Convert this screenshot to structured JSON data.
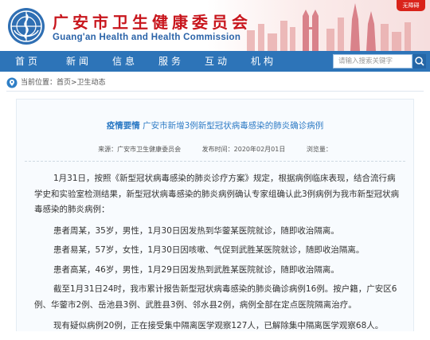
{
  "header": {
    "title": "广安市卫生健康委员会",
    "subtitle": "Guang'an Health and Health Commission",
    "corner_flag": "无障碍"
  },
  "nav": {
    "items": [
      "首页",
      "新闻",
      "信息",
      "服务",
      "互动",
      "机构"
    ],
    "search_placeholder": "请输入搜索关键字"
  },
  "breadcrumb": {
    "prefix": "当前位置：",
    "path": "首页>卫生动态"
  },
  "article": {
    "tag": "疫情要情",
    "title": "广安市新增3例新型冠状病毒感染的肺炎确诊病例",
    "source": "来源：广安市卫生健康委员会",
    "publish_time": "发布时间：2020年02月01日",
    "views": "浏览量：",
    "paragraphs": [
      "1月31日，按照《新型冠状病毒感染的肺炎诊疗方案》规定，根据病例临床表现，结合流行病学史和实验室检测结果，新型冠状病毒感染的肺炎病例确认专家组确认此3例病例为我市新型冠状病毒感染的肺炎病例：",
      "患者周某，35岁，男性，1月30日因发热到华蓥某医院就诊，随即收治隔离。",
      "患者易某，57岁，女性，1月30日因咳嗽、气促到武胜某医院就诊，随即收治隔离。",
      "患者高某，46岁，男性，1月29日因发热到武胜某医院就诊，随即收治隔离。",
      "截至1月31日24时，我市累计报告新型冠状病毒感染的肺炎确诊病例16例。按户籍，广安区6例、华蓥市2例、岳池县3例、武胜县3例、邻水县2例，病例全部在定点医院隔离治疗。",
      "现有疑似病例20例，正在接受集中隔离医学观察127人，已解除集中隔离医学观察68人。"
    ]
  },
  "colors": {
    "brand_red": "#c8161d",
    "nav_blue": "#2d74b8",
    "link_blue": "#2e7bc5"
  },
  "icons": [
    "emblem-icon",
    "skyline-graphic",
    "search-icon",
    "location-icon"
  ]
}
